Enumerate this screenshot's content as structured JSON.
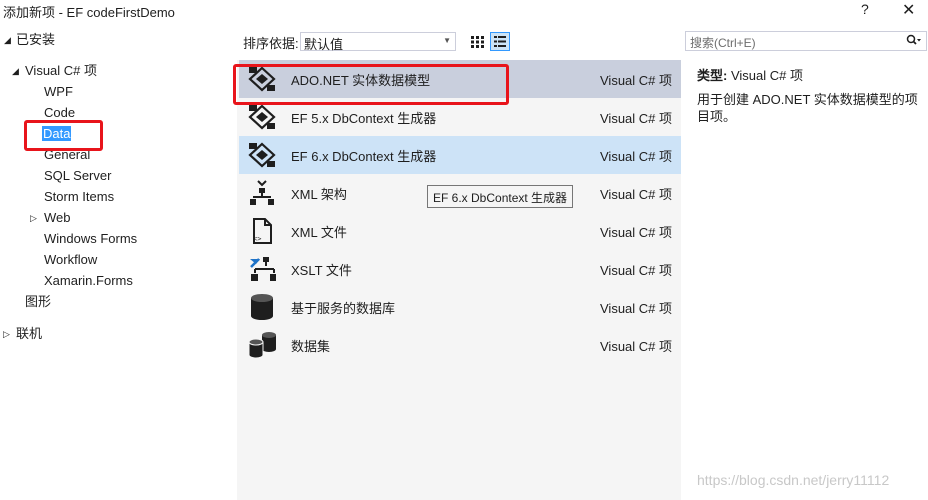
{
  "window": {
    "title": "添加新项 - EF  codeFirstDemo",
    "help_label": "?",
    "close_label": "✕"
  },
  "tree": {
    "installed": "已安装",
    "visual_csharp": "Visual C# 项",
    "children": [
      "WPF",
      "Code",
      "Data",
      "General",
      "SQL Server",
      "Storm Items",
      "Web",
      "Windows Forms",
      "Workflow",
      "Xamarin.Forms"
    ],
    "selected": "Data",
    "graphics": "图形",
    "online": "联机"
  },
  "toolbar": {
    "sort_label": "排序依据:",
    "sort_value": "默认值"
  },
  "items": [
    {
      "name": "ADO.NET 实体数据模型",
      "category": "Visual C# 项",
      "icon": "entity-model-icon"
    },
    {
      "name": "EF 5.x DbContext 生成器",
      "category": "Visual C# 项",
      "icon": "entity-model-icon"
    },
    {
      "name": "EF 6.x DbContext 生成器",
      "category": "Visual C# 项",
      "icon": "entity-model-icon"
    },
    {
      "name": "XML 架构",
      "category": "Visual C# 项",
      "icon": "xml-schema-icon"
    },
    {
      "name": "XML 文件",
      "category": "Visual C# 项",
      "icon": "xml-file-icon"
    },
    {
      "name": "XSLT 文件",
      "category": "Visual C# 项",
      "icon": "xslt-file-icon"
    },
    {
      "name": "基于服务的数据库",
      "category": "Visual C# 项",
      "icon": "database-icon"
    },
    {
      "name": "数据集",
      "category": "Visual C# 项",
      "icon": "dataset-icon"
    }
  ],
  "tooltip": "EF 6.x DbContext 生成器",
  "search": {
    "placeholder": "搜索(Ctrl+E)"
  },
  "details": {
    "type_key": "类型:",
    "type_value": "Visual C# 项",
    "description": "用于创建 ADO.NET 实体数据模型的项目项。"
  },
  "watermark": "https://blog.csdn.net/jerry11112",
  "colors": {
    "selection": "#3399ff",
    "highlight_box": "#e8141b",
    "row_selected": "#cde3f7",
    "row_hover": "#c9cfdd"
  }
}
